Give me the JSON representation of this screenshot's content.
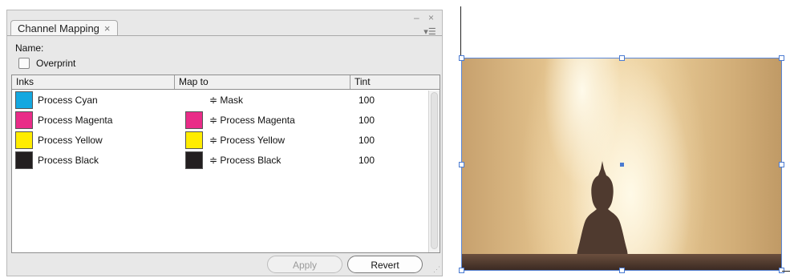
{
  "panel": {
    "tab_label": "Channel Mapping",
    "close_glyph": "×",
    "window_controls": "– ×",
    "menu_glyph": "▾☰",
    "name_label": "Name:",
    "overprint_label": "Overprint",
    "overprint_checked": false
  },
  "table": {
    "headers": {
      "inks": "Inks",
      "map_to": "Map to",
      "tint": "Tint"
    },
    "rows": [
      {
        "ink": "Process Cyan",
        "ink_color": "#14a8e0",
        "map": "≑ Mask",
        "map_color": null,
        "tint": "100"
      },
      {
        "ink": "Process Magenta",
        "ink_color": "#e92c88",
        "map": "≑ Process Magenta",
        "map_color": "#e92c88",
        "tint": "100"
      },
      {
        "ink": "Process Yellow",
        "ink_color": "#ffec00",
        "map": "≑ Process Yellow",
        "map_color": "#ffec00",
        "tint": "100"
      },
      {
        "ink": "Process Black",
        "ink_color": "#231f20",
        "map": "≑ Process Black",
        "map_color": "#231f20",
        "tint": "100"
      }
    ]
  },
  "buttons": {
    "apply": "Apply",
    "revert": "Revert",
    "apply_enabled": false
  },
  "colors": {
    "selection": "#4b7bd1"
  }
}
